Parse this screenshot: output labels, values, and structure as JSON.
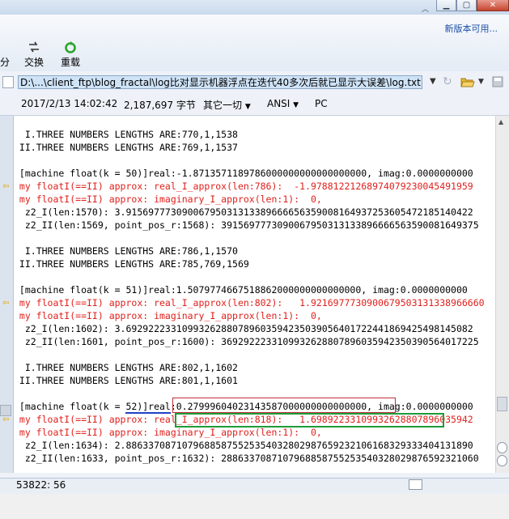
{
  "toolbar": {
    "partial_label": "分",
    "swap_label": "交换",
    "reload_label": "重载",
    "new_version_link": "新版本可用..."
  },
  "path": {
    "value": "D:\\...\\client_ftp\\blog_fractal\\log比对显示机器浮点在迭代40多次后就已显示大误差\\log.txt"
  },
  "fileinfo": {
    "datetime": "2017/2/13 14:02:42",
    "size": "2,187,697 字节",
    "other": "其它一切",
    "encoding": "ANSI",
    "lineending": "PC"
  },
  "lines": [
    "  I.THREE NUMBERS LENGTHS ARE:770,1,1538",
    " II.THREE NUMBERS LENGTHS ARE:769,1,1537",
    "",
    " [machine float(k = 50)]real:-1.8713571189786000000000000000000, imag:0.0000000000",
    " my floatI(==II) approx: real_I_approx(len:786):  -1.97881221268974079230045491959",
    " my floatI(==II) approx: imaginary_I_approx(len:1):  0,",
    "  z2_I(len:1570): 3.91569777309006795031313389666656359008164937253605472185140422",
    "  z2_II(len:1569, point_pos_r:1568): 3915697773090067950313133896666563590081649375",
    "",
    "  I.THREE NUMBERS LENGTHS ARE:786,1,1570",
    " II.THREE NUMBERS LENGTHS ARE:785,769,1569",
    "",
    " [machine float(k = 51)]real:1.5079774667518862000000000000000, imag:0.0000000000",
    " my floatI(==II) approx: real_I_approx(len:802):   1.9216977730900679503131338966660",
    " my floatI(==II) approx: imaginary_I_approx(len:1):  0,",
    "  z2_I(len:1602): 3.69292223310993262880789603594235039056401722441869425498145082",
    "  z2_II(len:1601, point_pos_r:1600): 3692922233109932628807896035942350390564017225",
    "",
    "  I.THREE NUMBERS LENGTHS ARE:802,1,1602",
    " II.THREE NUMBERS LENGTHS ARE:801,1,1601",
    "",
    " [machine float(k = 52)]real:0.27999604023143587000000000000000, imag:0.0000000000",
    " my floatI(==II) approx: real_I_approx(len:818):   1.69892233109932628807896035942",
    " my floatI(==II) approx: imaginary_I_approx(len:1):  0,",
    "  z2_I(len:1634): 2.88633708710796885875525354032802987659232106168329333404131890",
    "  z2_II(len:1633, point_pos_r:1632): 2886337087107968858755253540328029876592321060"
  ],
  "status": {
    "position": "53822: 56"
  },
  "icons": {
    "swap": "swap-icon",
    "reload": "reload-icon",
    "folder": "folder-open-icon",
    "save": "save-icon",
    "dropdown": "chevron-down-icon",
    "marker": "arrow-left-icon"
  },
  "colors": {
    "error_text": "#e0201c",
    "highlight_red_box": "#c0303a",
    "highlight_green_box": "#1f9b3a",
    "underline_blue": "#2040c8",
    "path_background": "#cfe3f7"
  }
}
